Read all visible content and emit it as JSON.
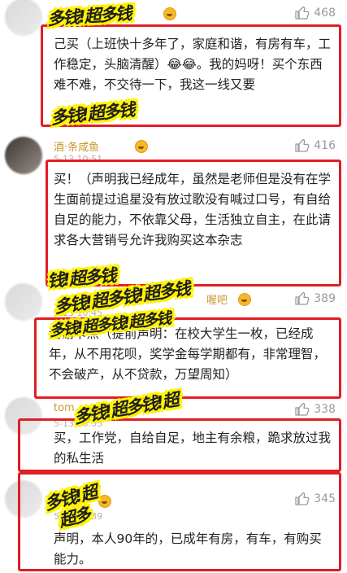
{
  "comments": [
    {
      "name": "",
      "time": "",
      "likes": "468",
      "text": "己买（上班快十多年了，家庭和谐，有房有车，工作稳定，头脑清醒）😂😂。我的妈呀！买个东西难不难，不交待一下，我这一线又要"
    },
    {
      "name": "酒·条咸鱼",
      "time": "5-13 10:51",
      "likes": "416",
      "text": "买！（声明我已经成年，虽然是老师但是没有在学生面前提过追星没有放过歌没有喊过口号，有自给自足的能力，不依靠父母，生活独立自主，在此请求各大营销号允许我购买这本杂志"
    },
    {
      "name": "喔吧",
      "time": "5-13 10:45",
      "likes": "389",
      "text": "谢谢卡点（提前声明：在校大学生一枚，已经成年，从不用花呗，奖学金每学期都有，非常理智，不会破产，从不贷款，万望周知）"
    },
    {
      "name": "tom",
      "time": "5-13 10:55",
      "likes": "338",
      "text": "买，工作党，自给自足，地主有余粮，跪求放过我的私生活"
    },
    {
      "name": "",
      "time": "5-13 10:39",
      "likes": "345",
      "text": "声明，本人90年的，已成年有房，有车，有购买能力。"
    }
  ],
  "stickers": [
    "多钱!超多钱",
    "多钱!超多钱",
    "钱!超多钱",
    "多钱!超多钱!超多钱",
    "多钱!超多钱!超多钱",
    "多钱!超多钱!超",
    "多钱!超",
    "超多"
  ],
  "colors": {
    "highlight_box": "#e21d25",
    "sticker_yellow": "#fff200",
    "like_gray": "#9a9a9a"
  }
}
